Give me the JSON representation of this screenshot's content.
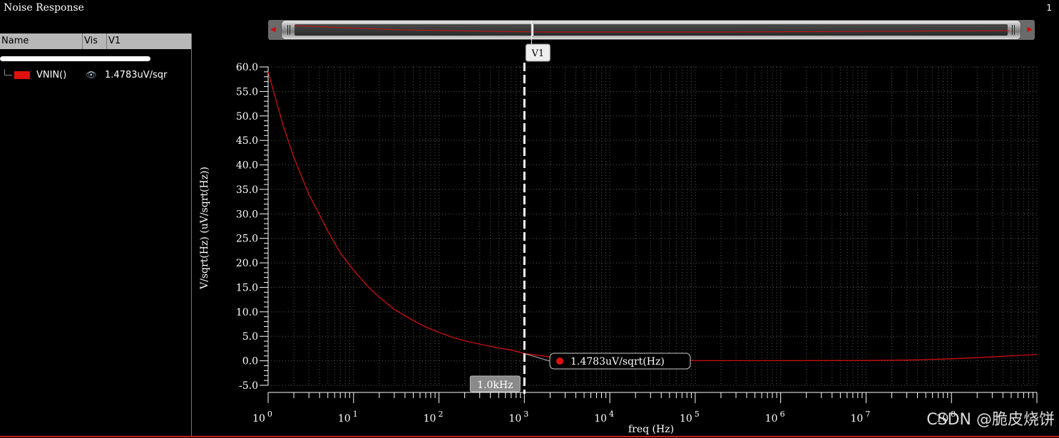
{
  "window": {
    "title": "Noise Response",
    "page_number": "1"
  },
  "legend": {
    "headers": {
      "name": "Name",
      "vis": "Vis",
      "v1": "V1"
    },
    "items": [
      {
        "name": "VNIN()",
        "value": "1.4783uV/sqr",
        "color": "#e01010",
        "visible_icon": "eye-icon"
      }
    ]
  },
  "marker": {
    "name": "V1",
    "x_label": "1.0kHz",
    "x_value": 1000,
    "readout": "1.4783uV/sqrt(Hz)",
    "y_value": 1.4783
  },
  "watermark": "CSDN @脆皮烧饼",
  "chart_data": {
    "type": "line",
    "title": "",
    "xlabel": "freq (Hz)",
    "ylabel": "V/sqrt(Hz) (uV/sqrt(Hz))",
    "xscale": "log",
    "xlim": [
      1,
      1000000000
    ],
    "ylim": [
      -5,
      60
    ],
    "yticks": [
      -5.0,
      0.0,
      5.0,
      10.0,
      15.0,
      20.0,
      25.0,
      30.0,
      35.0,
      40.0,
      45.0,
      50.0,
      55.0,
      60.0
    ],
    "ytick_labels": [
      "-5.0",
      "0.0",
      "5.0",
      "10.0",
      "15.0",
      "20.0",
      "25.0",
      "30.0",
      "35.0",
      "40.0",
      "45.0",
      "50.0",
      "55.0",
      "60.0"
    ],
    "xtick_base": "10",
    "xtick_exponents": [
      "0",
      "1",
      "2",
      "3",
      "4",
      "5",
      "6",
      "7",
      "8"
    ],
    "grid": true,
    "series": [
      {
        "name": "VNIN()",
        "color": "#e01010",
        "x": [
          1,
          1.5,
          2,
          3,
          5,
          7,
          10,
          15,
          20,
          30,
          50,
          70,
          100,
          150,
          200,
          300,
          500,
          700,
          1000,
          2000,
          5000,
          10000,
          100000,
          1000000,
          10000000,
          30000000,
          100000000,
          300000000,
          1000000000
        ],
        "y": [
          59,
          48,
          41.5,
          34,
          26.5,
          22,
          18.5,
          15,
          13,
          10.5,
          8.2,
          6.9,
          5.8,
          4.7,
          4.1,
          3.4,
          2.6,
          2.2,
          1.4783,
          0.8,
          0.4,
          0.2,
          0.05,
          0.05,
          0.08,
          0.15,
          0.4,
          0.8,
          1.3
        ]
      }
    ]
  }
}
